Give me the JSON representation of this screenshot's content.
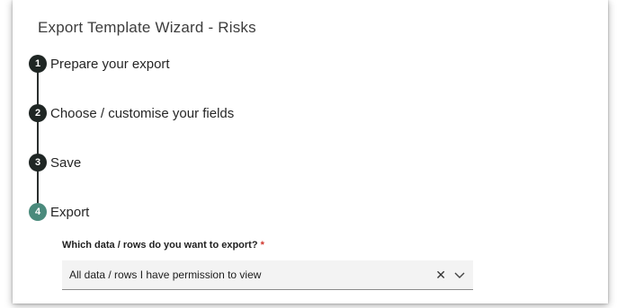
{
  "wizard": {
    "title": "Export Template Wizard - Risks",
    "steps": [
      {
        "number": "1",
        "label": "Prepare your export",
        "state": "complete",
        "color": "#1f2624"
      },
      {
        "number": "2",
        "label": "Choose / customise your fields",
        "state": "complete",
        "color": "#1f2624"
      },
      {
        "number": "3",
        "label": "Save",
        "state": "complete",
        "color": "#1f2624"
      },
      {
        "number": "4",
        "label": "Export",
        "state": "current",
        "color": "#4a8a7c"
      }
    ]
  },
  "export_field": {
    "label": "Which data / rows do you want to export?",
    "required_marker": "*",
    "value": "All data / rows I have permission to view",
    "clear_icon": "✕",
    "dropdown_icon": "chevron-down"
  }
}
